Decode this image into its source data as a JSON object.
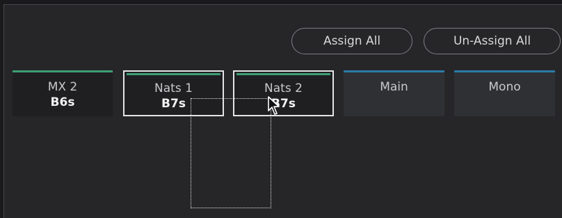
{
  "toolbar": {
    "assign_all_label": "Assign All",
    "unassign_all_label": "Un-Assign All"
  },
  "buses": [
    {
      "name": "MX 2",
      "bus": "B6s",
      "bar_color": "#3d9e74",
      "assigned": true,
      "selected": false
    },
    {
      "name": "Nats 1",
      "bus": "B7s",
      "bar_color": "#3d9e74",
      "assigned": true,
      "selected": true
    },
    {
      "name": "Nats 2",
      "bus": "B7s",
      "bar_color": "#3d9e74",
      "assigned": true,
      "selected": true
    },
    {
      "name": "Main",
      "bus": "",
      "bar_color": "#2b7ba8",
      "assigned": false,
      "selected": false
    },
    {
      "name": "Mono",
      "bus": "",
      "bar_color": "#2b7ba8",
      "assigned": false,
      "selected": false
    }
  ],
  "colors": {
    "panel_bg": "#262629",
    "selection_border": "#e4e4e6",
    "assigned_bar": "#3d9e74",
    "unassigned_bar": "#2b7ba8"
  },
  "icons": {
    "cursor": "arrow-pointer-icon",
    "marquee": "selection-marquee"
  }
}
